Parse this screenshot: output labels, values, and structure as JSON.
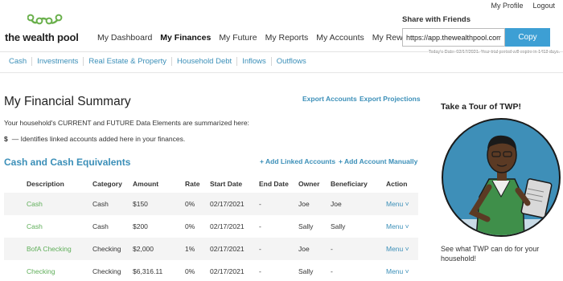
{
  "header": {
    "logo_text": "the wealth pool",
    "my_profile": "My Profile",
    "logout": "Logout",
    "nav": [
      {
        "label": "My Dashboard"
      },
      {
        "label": "My Finances"
      },
      {
        "label": "My Future"
      },
      {
        "label": "My Reports"
      },
      {
        "label": "My Accounts"
      },
      {
        "label": "My Rewards"
      }
    ],
    "active_nav": "My Finances"
  },
  "share": {
    "title": "Share with Friends",
    "url": "https://app.thewealthpool.com",
    "copy_label": "Copy",
    "trial_text": "Today's Date: 02/17/2021. Your trial period will expire in 1413 days."
  },
  "subnav": [
    {
      "label": "Cash"
    },
    {
      "label": "Investments"
    },
    {
      "label": "Real Estate & Property"
    },
    {
      "label": "Household Debt"
    },
    {
      "label": "Inflows"
    },
    {
      "label": "Outflows"
    }
  ],
  "summary": {
    "title": "My Financial Summary",
    "export_accounts": "Export Accounts",
    "export_projections": "Export Projections",
    "intro": "Your household's CURRENT and FUTURE Data Elements are summarized here:",
    "legend_symbol": "$",
    "legend_text": "— Identifies linked accounts added here in your finances."
  },
  "cash_section": {
    "title": "Cash and Cash Equivalents",
    "add_linked": "+ Add Linked Accounts",
    "add_manual": "+ Add Account Manually",
    "columns": [
      "Description",
      "Category",
      "Amount",
      "Rate",
      "Start Date",
      "End Date",
      "Owner",
      "Beneficiary",
      "Action"
    ],
    "rows": [
      {
        "description": "Cash",
        "category": "Cash",
        "amount": "$150",
        "rate": "0%",
        "start": "02/17/2021",
        "end": "-",
        "owner": "Joe",
        "beneficiary": "Joe",
        "action": "Menu ˅"
      },
      {
        "description": "Cash",
        "category": "Cash",
        "amount": "$200",
        "rate": "0%",
        "start": "02/17/2021",
        "end": "-",
        "owner": "Sally",
        "beneficiary": "Sally",
        "action": "Menu ˅"
      },
      {
        "description": "BofA Checking",
        "category": "Checking",
        "amount": "$2,000",
        "rate": "1%",
        "start": "02/17/2021",
        "end": "-",
        "owner": "Joe",
        "beneficiary": "-",
        "action": "Menu ˅"
      },
      {
        "description": "Checking",
        "category": "Checking",
        "amount": "$6,316.11",
        "rate": "0%",
        "start": "02/17/2021",
        "end": "-",
        "owner": "Sally",
        "beneficiary": "-",
        "action": "Menu ˅"
      }
    ]
  },
  "tour": {
    "title": "Take a Tour of TWP!",
    "caption": "See what TWP can do for your household!"
  },
  "colors": {
    "accent_blue": "#3d9fd4",
    "link_blue": "#3b8fb8",
    "green": "#5fae59",
    "circle_blue": "#3e8fb8"
  }
}
